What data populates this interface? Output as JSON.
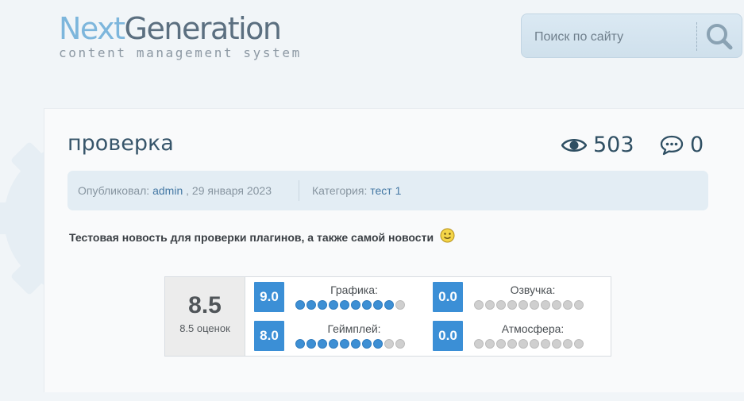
{
  "brand": {
    "name_part1": "Next",
    "name_part2": "Generation",
    "tagline": "content management system"
  },
  "search": {
    "placeholder": "Поиск по сайту",
    "button_icon": "magnifier-icon"
  },
  "post": {
    "title": "проверка",
    "views": "503",
    "comments": "0",
    "views_icon": "eye-icon",
    "comments_icon": "speech-bubble-icon",
    "meta": {
      "published_label": "Опубликовал:",
      "author": "admin",
      "date": ", 29 января 2023",
      "category_label": "Категория:",
      "category": "тест 1"
    },
    "text": "Тестовая новость для проверки плагинов, а также самой новости",
    "emoticon": "smiley-icon"
  },
  "rating": {
    "overall_score": "8.5",
    "overall_count": "8.5 оценок",
    "max_dots": 10,
    "criteria": [
      {
        "label": "Графика:",
        "score": "9.0",
        "filled": 9
      },
      {
        "label": "Озвучка:",
        "score": "0.0",
        "filled": 0
      },
      {
        "label": "Геймплей:",
        "score": "8.0",
        "filled": 8
      },
      {
        "label": "Атмосфера:",
        "score": "0.0",
        "filled": 0
      }
    ]
  },
  "colors": {
    "accent": "#3b8fd6",
    "title": "#37556a",
    "link": "#4478a4"
  }
}
